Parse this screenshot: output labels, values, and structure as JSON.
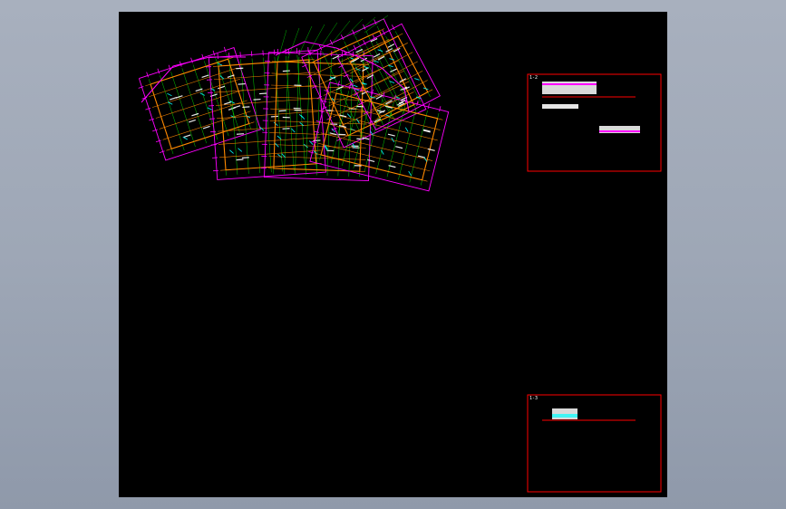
{
  "viewer": {
    "background_color": "#9ea7b6",
    "canvas_color": "#000000"
  },
  "drawing": {
    "plan_name": "floor-plan",
    "colors": {
      "dimension": "#ff00ff",
      "grid": "#00ff00",
      "wall": "#ff8800",
      "axis": "#ffffff",
      "frame": "#ff0000",
      "annotation": "#00ffff"
    }
  },
  "title_blocks": [
    {
      "tag": "1-2",
      "title": "██████████",
      "subtitle": "████ █ ██"
    },
    {
      "tag": "1-3",
      "title": "████",
      "subtitle": ""
    }
  ]
}
